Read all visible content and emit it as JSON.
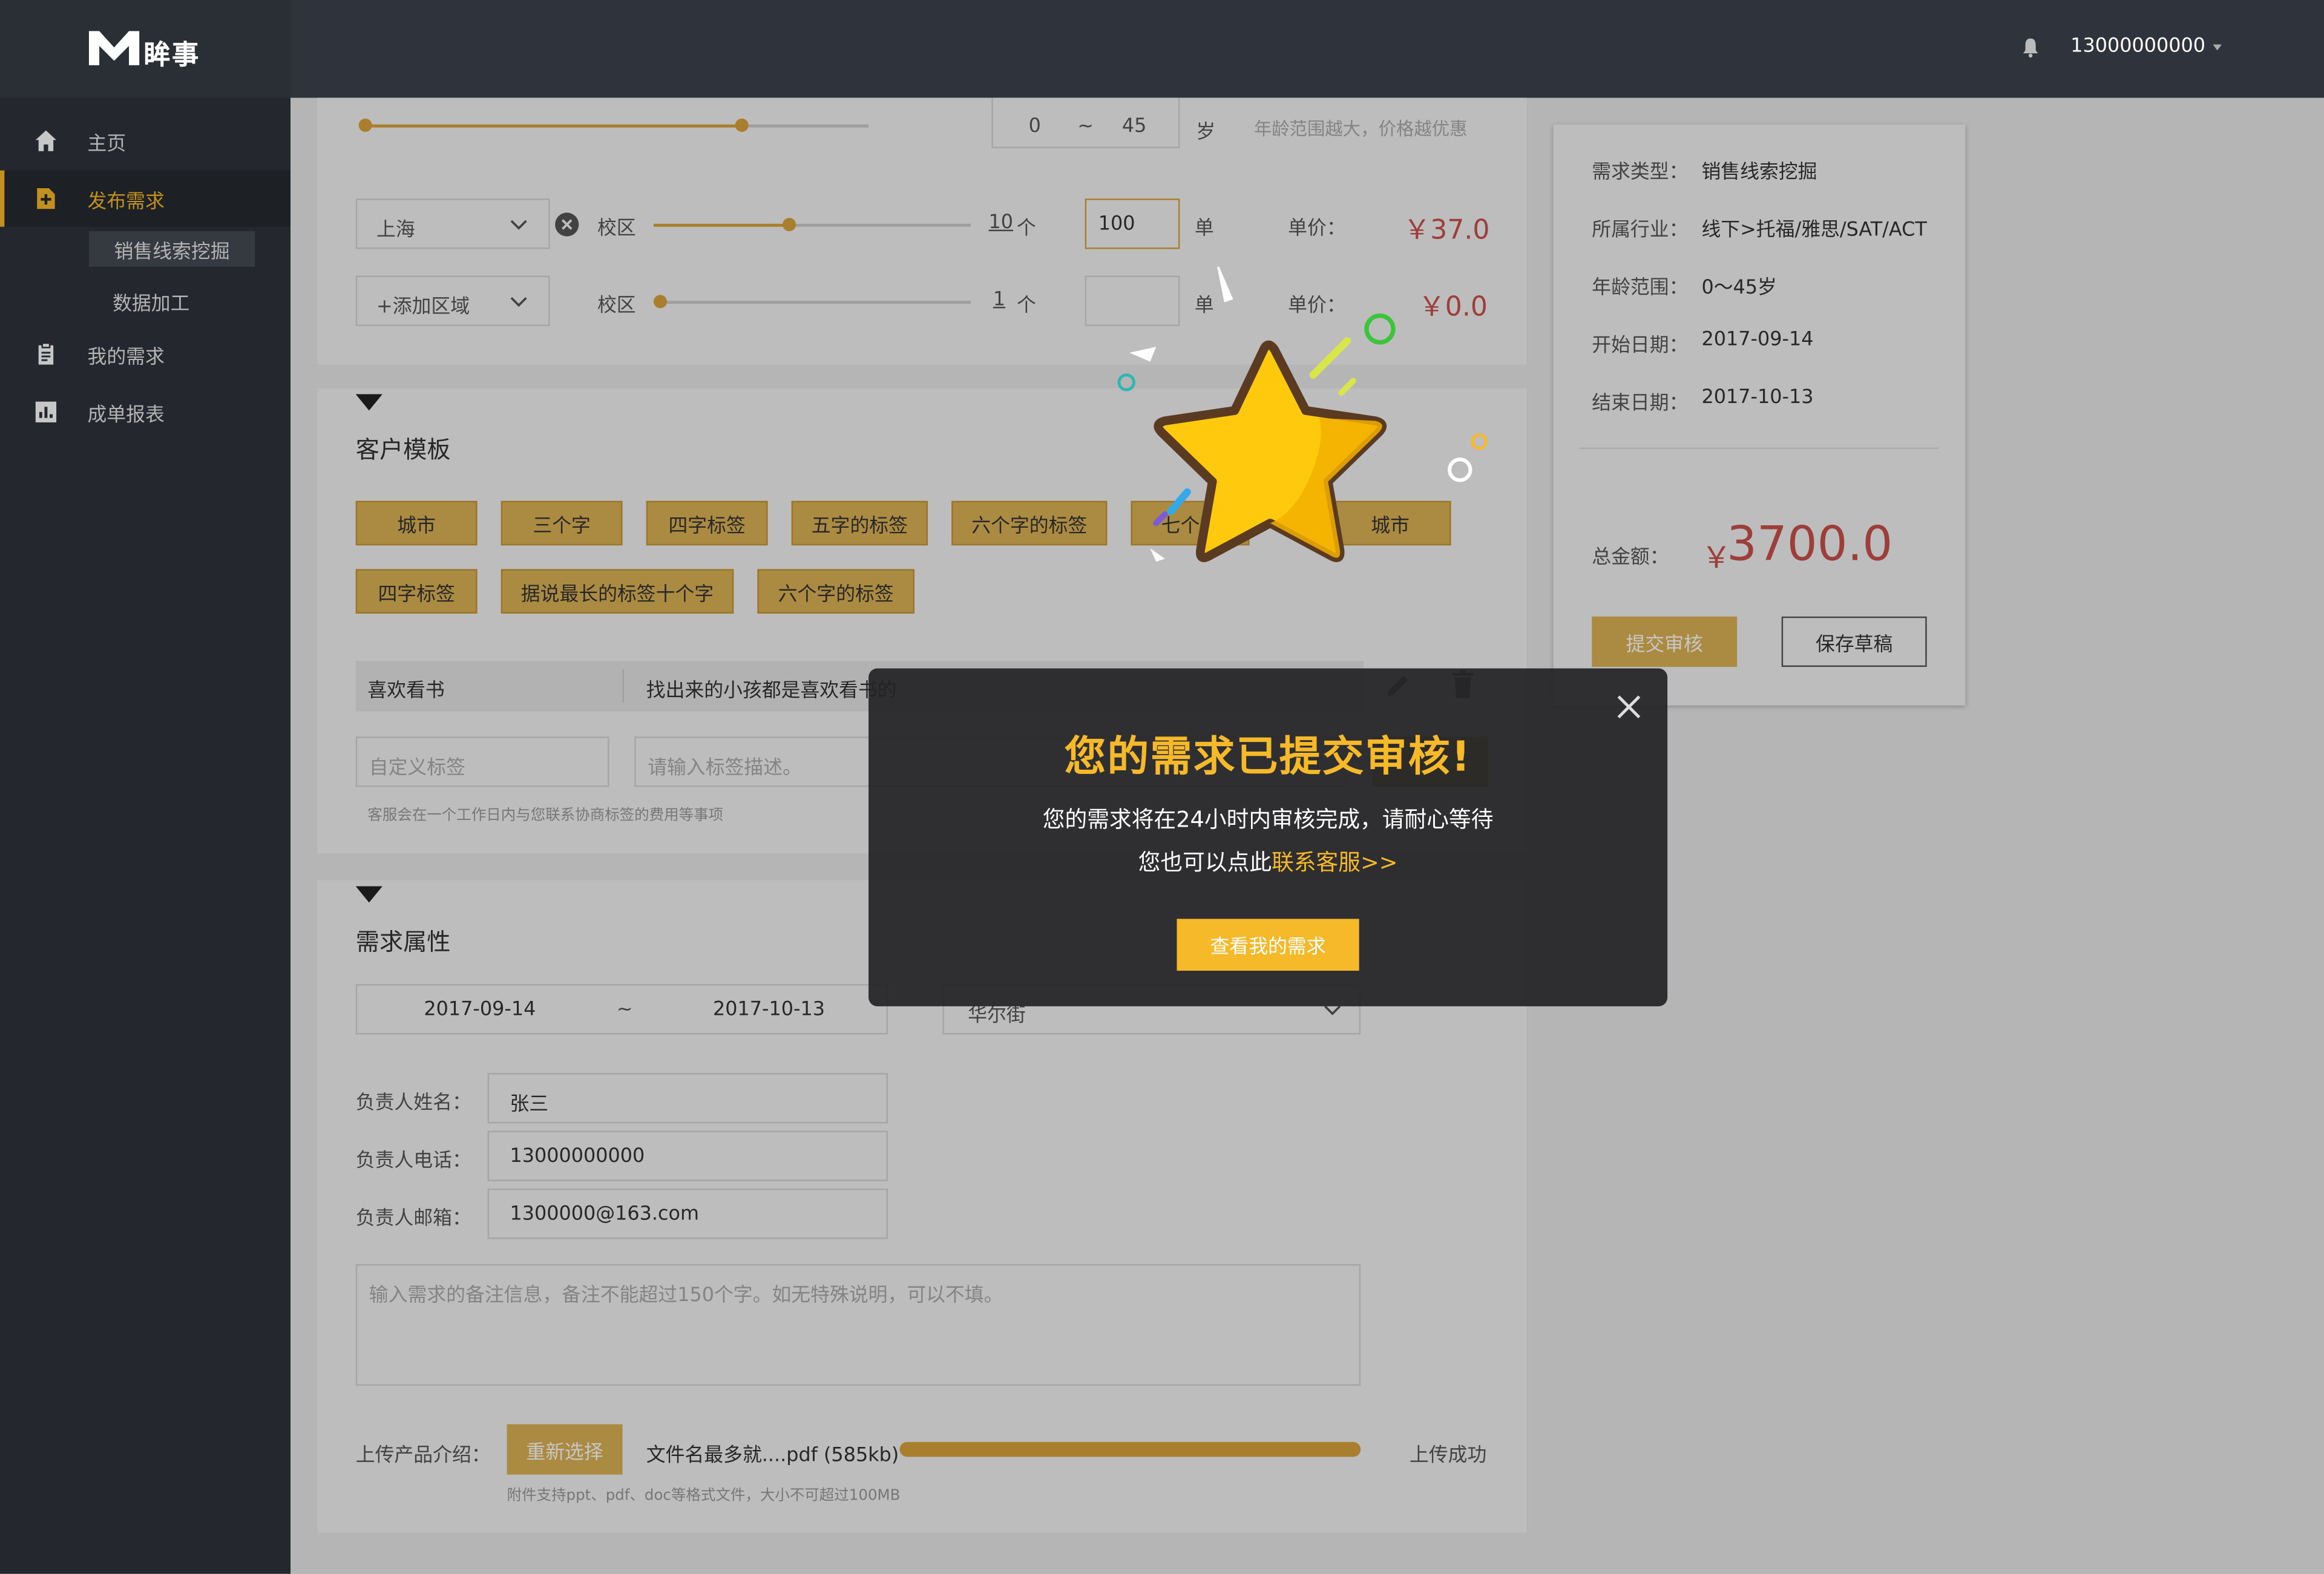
{
  "app": {
    "logo_text": "眸事",
    "phone": "13000000000"
  },
  "sidebar": {
    "items": [
      {
        "label": "主页",
        "icon": "home-icon"
      },
      {
        "label": "发布需求",
        "icon": "post-icon"
      },
      {
        "label": "我的需求",
        "icon": "clipboard-icon"
      },
      {
        "label": "成单报表",
        "icon": "chart-icon"
      }
    ],
    "sub_items": [
      {
        "label": "销售线索挖掘"
      },
      {
        "label": "数据加工"
      }
    ]
  },
  "region": {
    "row_top": {
      "age_from": "0",
      "age_sep": "~",
      "age_to": "45",
      "age_unit": "岁",
      "age_hint": "年龄范围越大，价格越优惠"
    },
    "rows": [
      {
        "city": "上海",
        "label": "校区",
        "count": "10",
        "count_unit": "个",
        "orders": "100",
        "orders_unit": "单",
        "price_label": "单价：",
        "price": "￥37.0"
      },
      {
        "city": "+添加区域",
        "label": "校区",
        "count": "1",
        "count_unit": "个",
        "orders": "",
        "orders_unit": "单",
        "price_label": "单价：",
        "price": "￥0.0"
      }
    ]
  },
  "customer_template": {
    "title": "客户模板",
    "tags_row1": [
      "城市",
      "三个字",
      "四字标签",
      "五字的标签",
      "六个字的标签",
      "七个字",
      "城市"
    ],
    "tags_row2": [
      "四字标签",
      "据说最长的标签十个字",
      "六个字的标签"
    ],
    "custom_tag": {
      "name": "喜欢看书",
      "desc": "找出来的小孩都是喜欢看书的"
    },
    "new_tag_placeholder": "自定义标签",
    "new_desc_placeholder": "请输入标签描述。",
    "hint": "客服会在一个工作日内与您联系协商标签的费用等事项"
  },
  "requirement": {
    "title": "需求属性",
    "date_from": "2017-09-14",
    "date_sep": "~",
    "date_to": "2017-10-13",
    "district": "华尔街",
    "owner_name_label": "负责人姓名：",
    "owner_name": "张三",
    "owner_phone_label": "负责人电话：",
    "owner_phone": "13000000000",
    "owner_email_label": "负责人邮箱：",
    "owner_email": "1300000@163.com",
    "remark_placeholder": "输入需求的备注信息，备注不能超过150个字。如无特殊说明，可以不填。",
    "upload_label": "上传产品介绍：",
    "reselect_label": "重新选择",
    "file_name": "文件名最多就....pdf (585kb)",
    "upload_progress": 1.0,
    "upload_status": "上传成功",
    "upload_hint": "附件支持ppt、pdf、doc等格式文件，大小不可超过100MB"
  },
  "summary": {
    "rows": [
      {
        "label": "需求类型：",
        "value": "销售线索挖掘"
      },
      {
        "label": "所属行业：",
        "value": "线下>托福/雅思/SAT/ACT"
      },
      {
        "label": "年龄范围：",
        "value": "0～45岁"
      },
      {
        "label": "开始日期：",
        "value": "2017-09-14"
      },
      {
        "label": "结束日期：",
        "value": "2017-10-13"
      }
    ],
    "total_label": "总金额：",
    "total_currency": "￥",
    "total_value": "3700.0",
    "submit_label": "提交审核",
    "draft_label": "保存草稿"
  },
  "modal": {
    "title": "您的需求已提交审核!",
    "line1": "您的需求将在24小时内审核完成，请耐心等待",
    "line2_prefix": "您也可以点此",
    "line2_link": "联系客服>>",
    "button": "查看我的需求"
  },
  "colors": {
    "accent": "#f6b929",
    "sidebar": "#2f333b",
    "price_red": "#c8504a",
    "tag": "#dcb254"
  }
}
